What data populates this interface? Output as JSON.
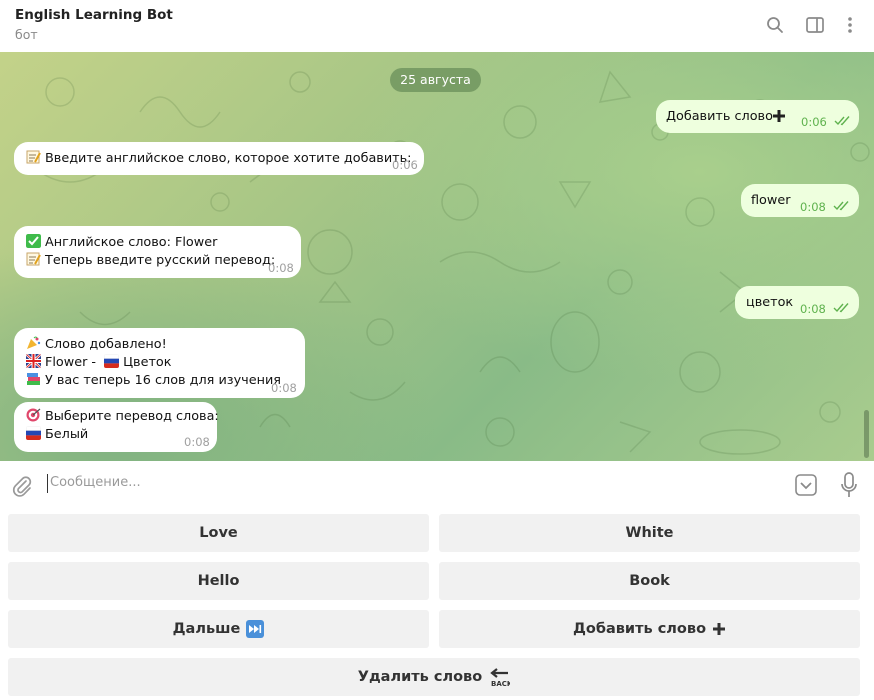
{
  "header": {
    "title": "English Learning Bot",
    "subtitle": "бот",
    "icons": [
      "search-icon",
      "sidebar-toggle-icon",
      "more-vertical-icon"
    ]
  },
  "chat": {
    "date": "25 августа",
    "messages": [
      {
        "dir": "out",
        "text": "Добавить слово ➕",
        "time": "0:06"
      },
      {
        "dir": "in",
        "lines": [
          "📝 Введите английское слово, которое хотите добавить:"
        ],
        "time": "0:06"
      },
      {
        "dir": "out",
        "text": "flower",
        "time": "0:08"
      },
      {
        "dir": "in",
        "lines": [
          "✅ Английское слово: Flower",
          "📝 Теперь введите русский перевод:"
        ],
        "time": "0:08"
      },
      {
        "dir": "out",
        "text": "цветок",
        "time": "0:08"
      },
      {
        "dir": "in",
        "lines": [
          "🎉 Слово добавлено!",
          "🇬🇧 Flower - 🇷🇺 Цветок",
          "📚 У вас теперь 16 слов для изучения"
        ],
        "time": "0:08"
      },
      {
        "dir": "in",
        "lines": [
          "🎯 Выберите перевод слова:",
          "🇷🇺 Белый"
        ],
        "time": "0:08"
      }
    ],
    "line_text": {
      "m2l1": "Введите английское слово, которое хотите добавить:",
      "m4l1": "Английское слово: Flower",
      "m4l2": "Теперь введите русский перевод:",
      "m6l1": "Слово добавлено!",
      "m6l2a": "Flower -",
      "m6l2b": "Цветок",
      "m6l3": "У вас теперь 16 слов для изучения",
      "m7l1": "Выберите перевод слова:",
      "m7l2": "Белый",
      "m1": "Добавить слово",
      "m3": "flower",
      "m5": "цветок"
    }
  },
  "input": {
    "placeholder": "Сообщение...",
    "icons": [
      "attach-icon",
      "keyboard-toggle-icon",
      "microphone-icon"
    ]
  },
  "keyboard": {
    "love": "Love",
    "white": "White",
    "hello": "Hello",
    "book": "Book",
    "next": "Дальше",
    "add": "Добавить слово",
    "delete": "Удалить слово"
  },
  "colors": {
    "incoming_bubble": "#ffffff",
    "outgoing_bubble": "#eeffde",
    "outgoing_time": "#5fb24e",
    "date_pill": "#6a8f5a"
  }
}
